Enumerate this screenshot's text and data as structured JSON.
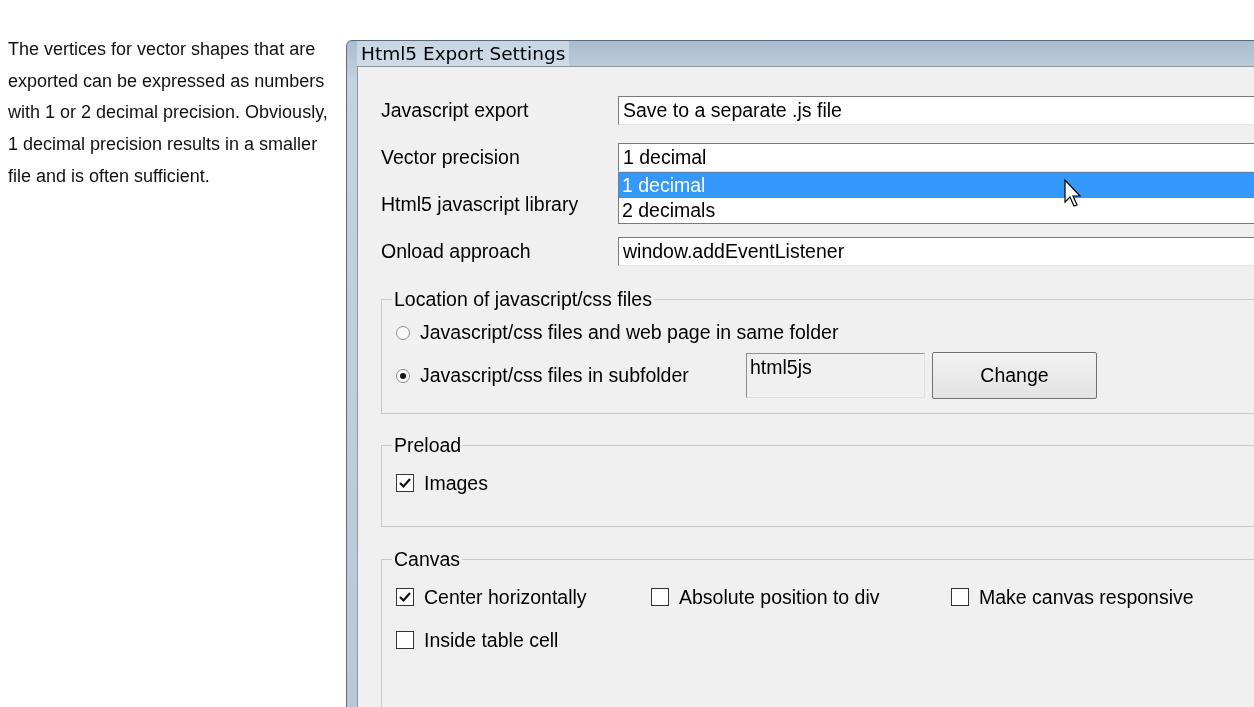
{
  "description": "The vertices for vector shapes that are exported can be expressed as numbers with 1 or 2 decimal precision. Obviously, 1 decimal precision results in a smaller file and is often sufficient.",
  "dialog": {
    "title": "Html5 Export Settings",
    "fields": [
      {
        "label": "Javascript export",
        "value": "Save to a separate .js file"
      },
      {
        "label": "Vector precision",
        "value": "1 decimal",
        "expanded": true,
        "options": [
          {
            "label": "1 decimal",
            "selected": true
          },
          {
            "label": "2 decimals",
            "selected": false
          }
        ]
      },
      {
        "label": "Html5 javascript library"
      },
      {
        "label": "Onload approach",
        "value": "window.addEventListener"
      }
    ],
    "location": {
      "title": "Location of javascript/css files",
      "options": [
        {
          "label": "Javascript/css files and web page in same folder",
          "selected": false
        },
        {
          "label": "Javascript/css files in subfolder",
          "selected": true
        }
      ],
      "folder": "html5js",
      "button": "Change"
    },
    "preload": {
      "title": "Preload",
      "options": [
        {
          "label": "Images",
          "checked": true
        }
      ]
    },
    "canvas": {
      "title": "Canvas",
      "options": [
        {
          "label": "Center horizontally",
          "checked": true
        },
        {
          "label": "Absolute position to div",
          "checked": false
        },
        {
          "label": "Make canvas responsive",
          "checked": false
        },
        {
          "label": "Inside table cell",
          "checked": false
        }
      ]
    }
  }
}
